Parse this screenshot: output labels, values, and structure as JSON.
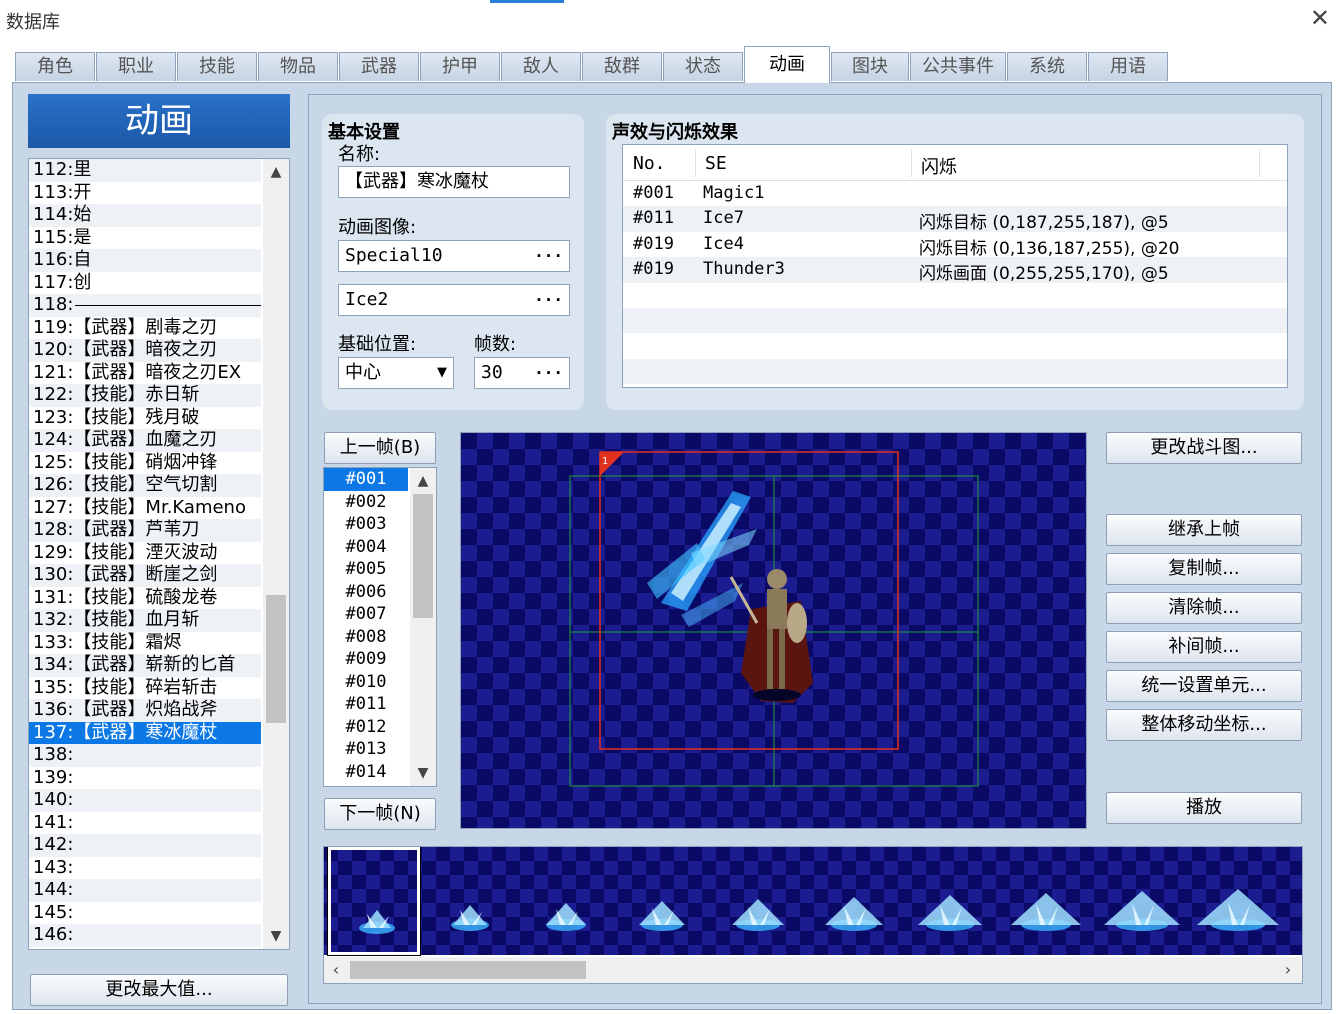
{
  "window": {
    "title": "数据库",
    "close_glyph": "✕"
  },
  "tabs": [
    "角色",
    "职业",
    "技能",
    "物品",
    "武器",
    "护甲",
    "敌人",
    "敌群",
    "状态",
    "动画",
    "图块",
    "公共事件",
    "系统",
    "用语"
  ],
  "active_tab_index": 9,
  "left": {
    "header": "动画",
    "items": [
      "112:里",
      "113:开",
      "114:始",
      "115:是",
      "116:自",
      "117:创",
      "118:",
      "119:【武器】剧毒之刃",
      "120:【武器】暗夜之刃",
      "121:【武器】暗夜之刃EX",
      "122:【技能】赤日斩",
      "123:【技能】残月破",
      "124:【武器】血魔之刃",
      "125:【技能】硝烟冲锋",
      "126:【技能】空气切割",
      "127:【技能】Mr.Kameno",
      "128:【武器】芦苇刀",
      "129:【技能】湮灭波动",
      "130:【武器】断崖之剑",
      "131:【技能】硫酸龙卷",
      "132:【技能】血月斩",
      "133:【技能】霜烬",
      "134:【武器】崭新的匕首",
      "135:【技能】碎岩斩击",
      "136:【武器】炽焰战斧",
      "137:【武器】寒冰魔杖",
      "138:",
      "139:",
      "140:",
      "141:",
      "142:",
      "143:",
      "144:",
      "145:",
      "146:"
    ],
    "selected_index": 25,
    "separator_index": 6,
    "change_max_label": "更改最大值..."
  },
  "basic": {
    "group_title": "基本设置",
    "name_label": "名称:",
    "name_value": "【武器】寒冰魔杖",
    "image_label": "动画图像:",
    "image1": "Special10",
    "image2": "Ice2",
    "position_label": "基础位置:",
    "position_value": "中心",
    "frames_label": "帧数:",
    "frames_value": "30"
  },
  "se": {
    "group_title": "声效与闪烁效果",
    "headers": [
      "No.",
      "SE",
      "闪烁"
    ],
    "rows": [
      {
        "no": "#001",
        "se": "Magic1",
        "flash": ""
      },
      {
        "no": "#011",
        "se": "Ice7",
        "flash": "闪烁目标 (0,187,255,187), @5"
      },
      {
        "no": "#019",
        "se": "Ice4",
        "flash": "闪烁目标 (0,136,187,255), @20"
      },
      {
        "no": "#019",
        "se": "Thunder3",
        "flash": "闪烁画面 (0,255,255,170), @5"
      }
    ]
  },
  "frames": {
    "prev_label": "上一帧(B)",
    "next_label": "下一帧(N)",
    "list": [
      "#001",
      "#002",
      "#003",
      "#004",
      "#005",
      "#006",
      "#007",
      "#008",
      "#009",
      "#010",
      "#011",
      "#012",
      "#013",
      "#014"
    ],
    "selected_index": 0
  },
  "canvas": {
    "cell_number": "1"
  },
  "actions": {
    "change_battler": "更改战斗图...",
    "inherit_prev": "继承上帧",
    "copy_frame": "复制帧...",
    "clear_frame": "清除帧...",
    "tween": "补间帧...",
    "batch_cell": "统一设置单元...",
    "shift_all": "整体移动坐标...",
    "play": "播放"
  },
  "filmstrip": {
    "cell_count": 10,
    "selected_index": 0
  },
  "colors": {
    "accent": "#0b78e6",
    "header_blue": "#1b58a8",
    "panel_bg": "#c8d7e8",
    "group_bg": "#dbe6f1",
    "canvas_dark": "#0a0a66",
    "canvas_light": "#1b1c90"
  }
}
